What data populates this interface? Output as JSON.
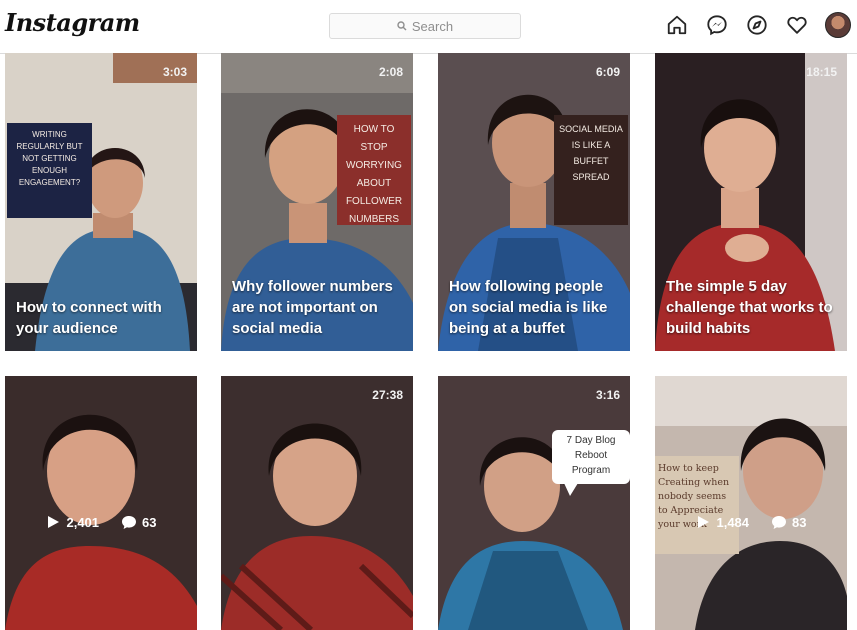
{
  "app": {
    "logo": "Instagram"
  },
  "search": {
    "placeholder": "Search"
  },
  "nav_icons": [
    "home-icon",
    "messenger-icon",
    "explore-icon",
    "heart-icon",
    "profile-avatar"
  ],
  "posts_row1": [
    {
      "duration": "3:03",
      "card": "WRITING REGULARLY BUT NOT GETTING ENOUGH ENGAGEMENT?",
      "caption": "How to connect with your audience"
    },
    {
      "duration": "2:08",
      "card": "HOW TO STOP WORRYING ABOUT FOLLOWER NUMBERS",
      "caption": "Why follower numbers are not important on social media"
    },
    {
      "duration": "6:09",
      "card": "SOCIAL MEDIA IS LIKE A BUFFET SPREAD",
      "caption": "How following people on social media is like being at a buffet"
    },
    {
      "duration": "18:15",
      "caption": "The simple 5 day challenge that works to build habits"
    }
  ],
  "posts_row2": [
    {
      "plays": "2,401",
      "comments": "63"
    },
    {
      "duration": "27:38"
    },
    {
      "duration": "3:16",
      "bubble": "7 Day Blog Reboot Program"
    },
    {
      "note": "How to keep Creating when nobody seems to Appreciate your work",
      "plays": "1,484",
      "comments": "83"
    }
  ],
  "colors": {
    "border": "#dbdbdb",
    "text": "#262626"
  }
}
